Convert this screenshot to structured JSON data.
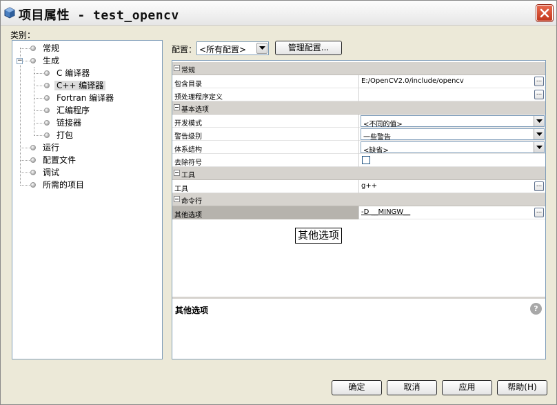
{
  "window": {
    "title": "项目属性 - test_opencv"
  },
  "categories": {
    "label": "类别：",
    "items": [
      {
        "label": "常规"
      },
      {
        "label": "生成"
      },
      {
        "label": "C 编译器"
      },
      {
        "label": "C++ 编译器"
      },
      {
        "label": "Fortran 编译器"
      },
      {
        "label": "汇编程序"
      },
      {
        "label": "链接器"
      },
      {
        "label": "打包"
      },
      {
        "label": "运行"
      },
      {
        "label": "配置文件"
      },
      {
        "label": "调试"
      },
      {
        "label": "所需的项目"
      }
    ]
  },
  "config": {
    "label": "配置：",
    "selected": "<所有配置>",
    "manage_button": "管理配置..."
  },
  "sheet": {
    "sections": [
      {
        "title": "常规",
        "rows": [
          {
            "name": "包含目录",
            "value": "E:/OpenCV2.0/include/opencv"
          },
          {
            "name": "预处理程序定义",
            "value": ""
          }
        ]
      },
      {
        "title": "基本选项",
        "rows": [
          {
            "name": "开发模式",
            "value": "<不同的值>"
          },
          {
            "name": "警告级别",
            "value": "一些警告"
          },
          {
            "name": "体系结构",
            "value": "<缺省>"
          },
          {
            "name": "去除符号",
            "value": ""
          }
        ]
      },
      {
        "title": "工具",
        "rows": [
          {
            "name": "工具",
            "value": "g++"
          }
        ]
      },
      {
        "title": "命令行",
        "rows": [
          {
            "name": "其他选项",
            "value": "-D __MINGW__"
          }
        ]
      }
    ],
    "tooltip": "其他选项"
  },
  "description": {
    "title": "其他选项",
    "help_icon": "?"
  },
  "buttons": {
    "ok": "确定",
    "cancel": "取消",
    "apply": "应用",
    "help": "帮助(H)"
  }
}
